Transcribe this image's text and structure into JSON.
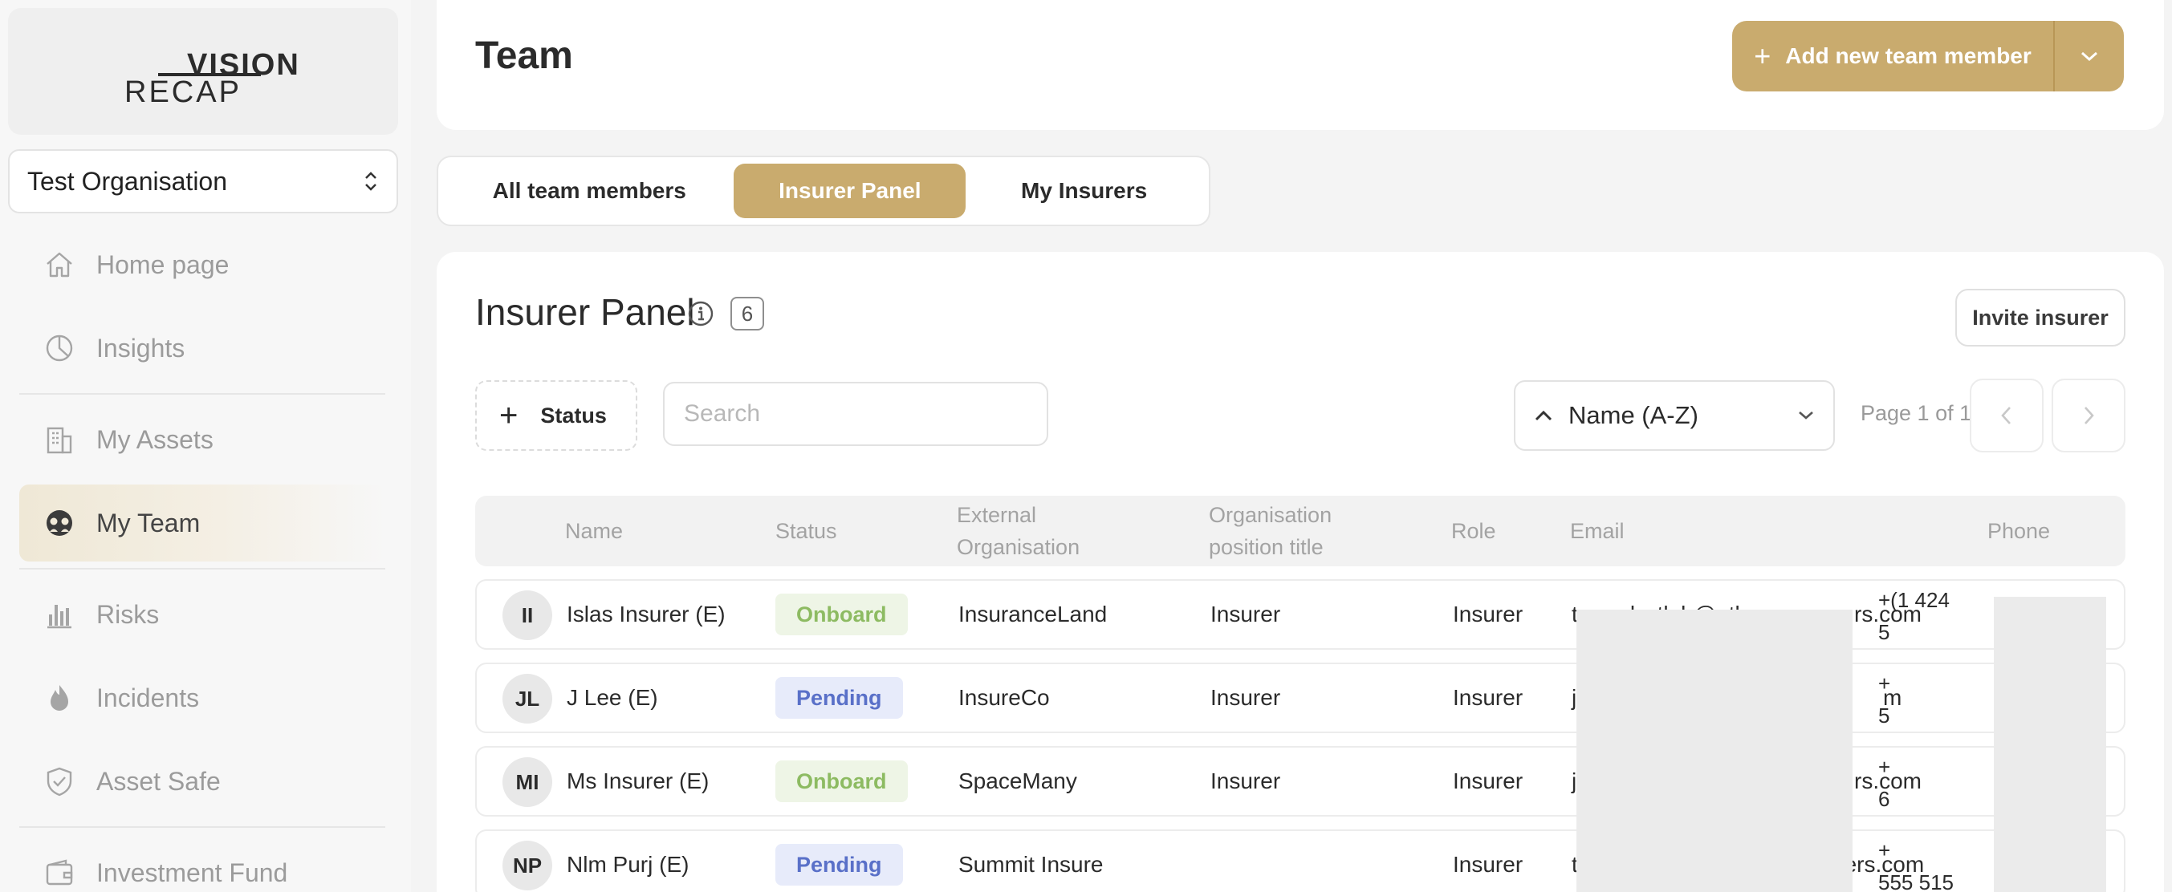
{
  "sidebar": {
    "logo": {
      "top": "VISION",
      "bottom": "RECAP"
    },
    "organisation": "Test Organisation",
    "items": [
      {
        "label": "Home page",
        "icon": "home-icon"
      },
      {
        "label": "Insights",
        "icon": "pie-chart-icon"
      },
      {
        "label": "My Assets",
        "icon": "building-icon"
      },
      {
        "label": "My Team",
        "icon": "team-icon",
        "active": true
      },
      {
        "label": "Risks",
        "icon": "bar-chart-icon"
      },
      {
        "label": "Incidents",
        "icon": "flame-icon"
      },
      {
        "label": "Asset Safe",
        "icon": "shield-icon"
      },
      {
        "label": "Investment Fund",
        "icon": "wallet-icon"
      }
    ]
  },
  "header": {
    "title": "Team",
    "add_button": "Add new team member"
  },
  "tabs": [
    {
      "label": "All team members",
      "active": false
    },
    {
      "label": "Insurer Panel",
      "active": true
    },
    {
      "label": "My Insurers",
      "active": false
    }
  ],
  "panel": {
    "title": "Insurer Panel",
    "count": "6",
    "invite_button": "Invite insurer",
    "status_filter": "Status",
    "search_placeholder": "Search",
    "sort": "Name (A-Z)",
    "page_info": "Page 1 of 1"
  },
  "table": {
    "columns": {
      "name": "Name",
      "status": "Status",
      "external_org_1": "External",
      "external_org_2": "Organisation",
      "position_1": "Organisation",
      "position_2": "position title",
      "role": "Role",
      "email": "Email",
      "phone": "Phone"
    },
    "rows": [
      {
        "initials": "II",
        "name": "Islas Insurer (E)",
        "status": "Onboard",
        "org": "InsuranceLand",
        "position": "Insurer",
        "role": "Insurer",
        "email_start": "t",
        "email_end": "rs.com",
        "email_mid": "ruvsky.tlab@atlasmca",
        "phone_1": "+(1 424",
        "phone_2": "5"
      },
      {
        "initials": "JL",
        "name": "J Lee (E)",
        "status": "Pending",
        "org": "InsureCo",
        "position": "Insurer",
        "role": "Insurer",
        "email_start": "j",
        "email_end": "m",
        "phone_1": "+",
        "phone_2": "5"
      },
      {
        "initials": "MI",
        "name": "Ms Insurer (E)",
        "status": "Onboard",
        "org": "SpaceMany",
        "position": "Insurer",
        "role": "Insurer",
        "email_start": "j",
        "email_end": "rs.com",
        "phone_1": "+",
        "phone_2": "6"
      },
      {
        "initials": "NP",
        "name": "Nlm Purj (E)",
        "status": "Pending",
        "org": "Summit Insure",
        "position": "",
        "role": "Insurer",
        "email_start": "t",
        "email_end": "ners.com",
        "phone_1": "+",
        "phone_2": "555 515"
      }
    ]
  },
  "colors": {
    "accent": "#c9ab6e",
    "onboard_text": "#8dbb62",
    "onboard_bg": "#eef5e6",
    "pending_text": "#5970c8",
    "pending_bg": "#e7ebfa"
  }
}
